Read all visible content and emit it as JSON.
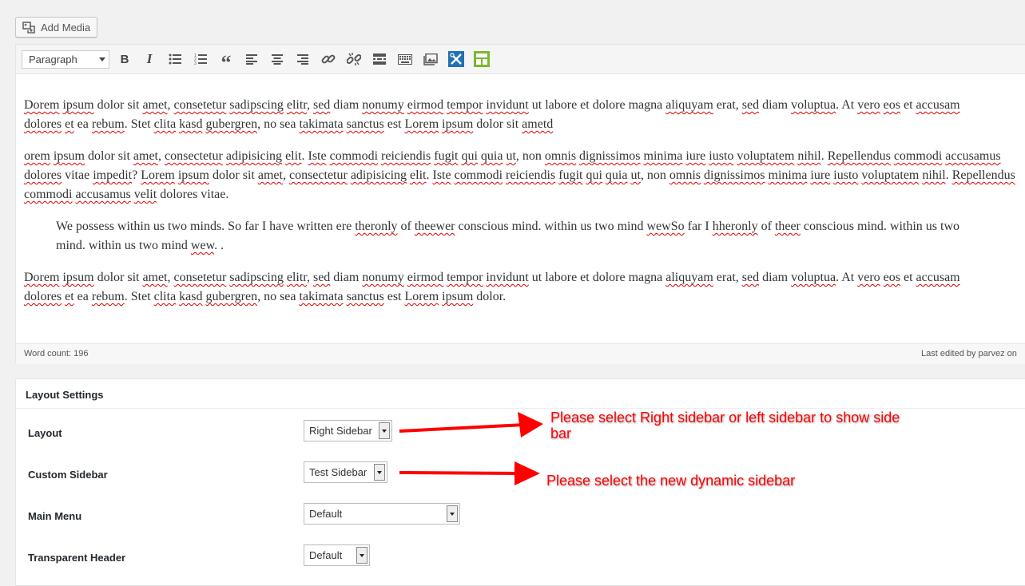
{
  "add_media": {
    "label": "Add Media"
  },
  "toolbar": {
    "format_select": "Paragraph",
    "buttons": [
      "bold",
      "italic",
      "bulleted-list",
      "numbered-list",
      "blockquote",
      "align-left",
      "align-center",
      "align-right",
      "insert-link",
      "remove-link",
      "read-more",
      "toolbar-toggle",
      "add-media-grid",
      "shortcodes",
      "page-builder"
    ]
  },
  "content": {
    "p1": {
      "l1": [
        "Dorem",
        " ",
        "ipsum",
        " dolor sit ",
        "amet",
        ", ",
        "consetetur",
        " ",
        "sadipscing",
        " ",
        "elitr",
        ", ",
        "sed",
        " diam ",
        "nonumy",
        " ",
        "eirmod",
        " ",
        "tempor",
        " ",
        "invidunt",
        " ut labore et dolore magna ",
        "aliquyam",
        " erat, ",
        "sed",
        " diam ",
        "voluptua",
        ". At ",
        "vero",
        " ",
        "eos",
        " et ",
        "accusam"
      ],
      "l2": [
        "dolores",
        " ",
        "et",
        " ea ",
        "rebum",
        ". Stet ",
        "clita",
        " ",
        "kasd",
        " ",
        "gubergren",
        ", no sea ",
        "takimata",
        " ",
        "sanctus",
        " est ",
        "Lorem",
        " ",
        "ipsum",
        " dolor sit ",
        "ametd"
      ]
    },
    "p2": {
      "l1": [
        "orem",
        " ",
        "ipsum",
        " dolor sit ",
        "amet",
        ", ",
        "consectetur",
        " ",
        "adipisicing",
        " ",
        "elit",
        ". ",
        "Iste",
        " ",
        "commodi",
        " ",
        "reiciendis",
        " ",
        "fugit",
        " ",
        "qui",
        " ",
        "quia",
        " ",
        "ut",
        ", non ",
        "omnis",
        " ",
        "dignissimos",
        " ",
        "minima",
        " ",
        "iure",
        " ",
        "iusto",
        " ",
        "voluptatem",
        " ",
        "nihil",
        ". ",
        "Repellendus",
        " ",
        "commodi",
        " ",
        "accusamus"
      ],
      "l2": [
        "dolores",
        " vitae ",
        "impedit",
        "? ",
        "Lorem",
        " ",
        "ipsum",
        " dolor sit ",
        "amet",
        ", ",
        "consectetur",
        " ",
        "adipisicing",
        " ",
        "elit",
        ". ",
        "Iste",
        " ",
        "commodi",
        " ",
        "reiciendis",
        " ",
        "fugit",
        " ",
        "qui",
        " ",
        "quia",
        " ",
        "ut",
        ", non ",
        "omnis",
        " ",
        "dignissimos",
        " ",
        "minima",
        " ",
        "iure",
        " ",
        "iusto",
        " ",
        "voluptatem",
        " ",
        "nihil",
        ". ",
        "Repellendus"
      ],
      "l3": [
        "commodi",
        " ",
        "accusamus",
        " ",
        "velit",
        " dolores vitae."
      ]
    },
    "quote": {
      "l1": [
        "We possess within us two minds. So far I have written ere ",
        "theronly",
        " of ",
        "theewer",
        " conscious mind. within us two mind ",
        "wewSo",
        " far I ",
        "hheronly",
        " of ",
        "theer",
        " conscious mind. within us two"
      ],
      "l2": [
        "mind. within us two mind ",
        "wew",
        ". ."
      ]
    },
    "p3": {
      "l1": [
        "Dorem",
        " ",
        "ipsum",
        " dolor sit ",
        "amet",
        ", ",
        "consetetur",
        " ",
        "sadipscing",
        " ",
        "elitr",
        ", ",
        "sed",
        " diam ",
        "nonumy",
        " ",
        "eirmod",
        " ",
        "tempor",
        " ",
        "invidunt",
        " ut labore et dolore magna ",
        "aliquyam",
        " erat, ",
        "sed",
        " diam ",
        "voluptua",
        ". At ",
        "vero",
        " ",
        "eos",
        " et ",
        "accusam"
      ],
      "l2": [
        "dolores",
        " ",
        "et",
        " ea ",
        "rebum",
        ". Stet ",
        "clita",
        " ",
        "kasd",
        " ",
        "gubergren",
        ", no sea ",
        "takimata",
        " ",
        "sanctus",
        " est ",
        "Lorem",
        " ",
        "ipsum",
        " dolor."
      ]
    }
  },
  "status": {
    "word_count": "Word count: 196",
    "last_edited": "Last edited by parvez on"
  },
  "layout_settings": {
    "title": "Layout Settings",
    "rows": [
      {
        "label": "Layout",
        "value": "Right Sidebar"
      },
      {
        "label": "Custom Sidebar",
        "value": "Test Sidebar"
      },
      {
        "label": "Main Menu",
        "value": "Default"
      },
      {
        "label": "Transparent Header",
        "value": "Default"
      }
    ]
  },
  "annotations": {
    "layout_line1": "Please select Right sidebar or left sidebar to show side",
    "layout_line2": "bar",
    "sidebar": "Please select the new dynamic sidebar"
  },
  "colors": {
    "annotation": "#ff0000",
    "shortcode_icon": "#2271b1",
    "builder_icon": "#7ab82c"
  }
}
